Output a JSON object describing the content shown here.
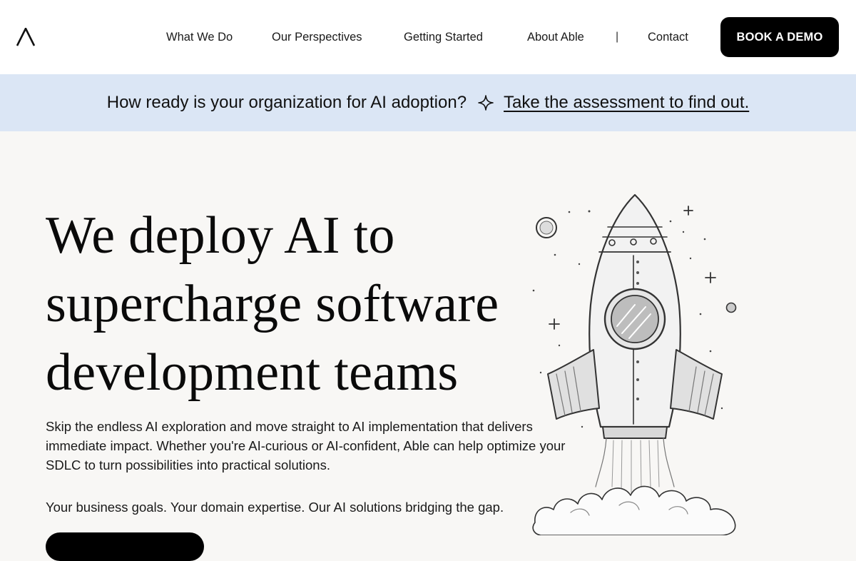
{
  "header": {
    "nav": [
      {
        "label": "What We Do"
      },
      {
        "label": "Our Perspectives"
      },
      {
        "label": "Getting Started"
      },
      {
        "label": "About Able"
      },
      {
        "label": "Contact"
      }
    ],
    "separator": "|",
    "cta_label": "BOOK A DEMO"
  },
  "banner": {
    "question": "How ready is your organization for AI adoption?",
    "link_text": "Take the assessment to find out."
  },
  "hero": {
    "title": "We deploy AI to supercharge software development teams",
    "body": "Skip the endless AI exploration and move straight to AI implementation that delivers immediate impact. Whether you're AI-curious or AI-confident, Able can help optimize your SDLC to turn possibilities into practical solutions.",
    "tagline": "Your business goals. Your domain expertise. Our AI solutions bridging the gap."
  },
  "colors": {
    "banner_bg": "#dbe6f5",
    "page_bg": "#f8f7f5",
    "cta_bg": "#000000"
  },
  "icons": {
    "logo": "able-logo-icon",
    "sparkle": "sparkle-icon",
    "illustration": "rocket-illustration"
  }
}
